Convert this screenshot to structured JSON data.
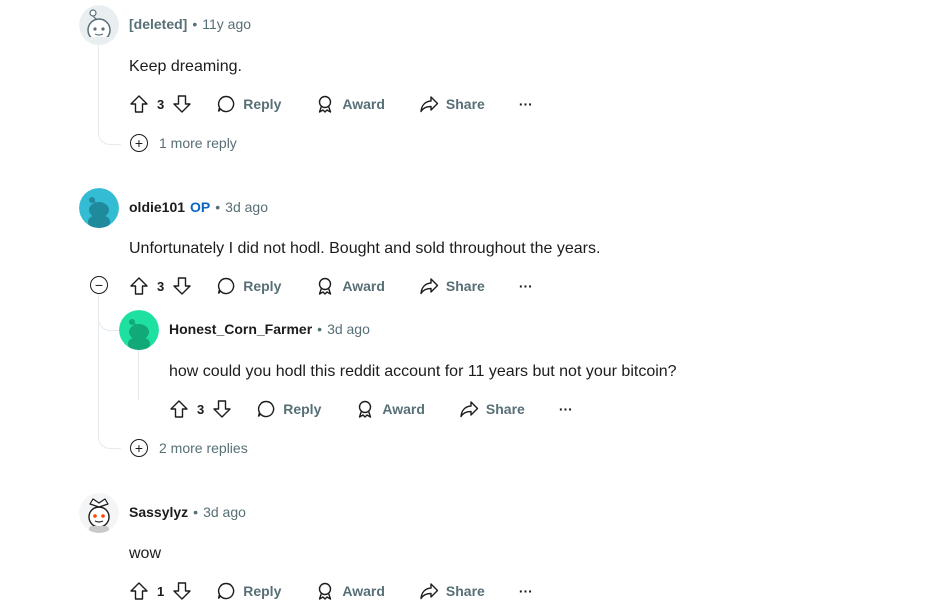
{
  "comments": [
    {
      "author": "[deleted]",
      "time": "11y ago",
      "text": "Keep dreaming.",
      "votes": "3",
      "more_replies": "1 more reply"
    },
    {
      "author": "oldie101",
      "op_badge": "OP",
      "time": "3d ago",
      "text": "Unfortunately I did not hodl. Bought and sold throughout the years.",
      "votes": "3"
    },
    {
      "author": "Honest_Corn_Farmer",
      "time": "3d ago",
      "text": "how could you hodl this reddit account for 11 years but not your bitcoin?",
      "votes": "3",
      "more_replies": "2 more replies"
    },
    {
      "author": "Sassylyz",
      "time": "3d ago",
      "text": "wow",
      "votes": "1"
    }
  ],
  "actions": {
    "reply": "Reply",
    "award": "Award",
    "share": "Share",
    "more": "···"
  },
  "colors": {
    "avatar_teal": "#33bcd3",
    "avatar_green": "#1ee0a0",
    "op_blue": "#0a65c2",
    "meta_gray": "#576f76"
  }
}
